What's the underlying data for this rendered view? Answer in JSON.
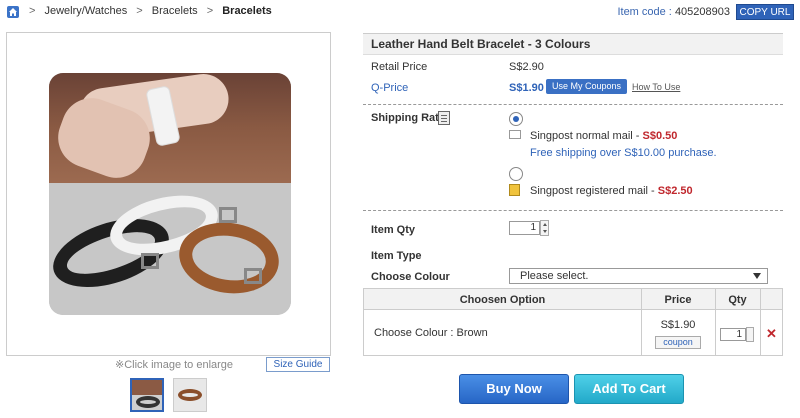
{
  "breadcrumb": {
    "items": [
      "Jewelry/Watches",
      "Bracelets",
      "Bracelets"
    ],
    "separator": ">"
  },
  "item_code": {
    "label": "Item code :",
    "value": "405208903"
  },
  "copy_url_label": "COPY URL",
  "gallery": {
    "enlarge_hint": "※Click image to enlarge",
    "size_guide_label": "Size Guide",
    "thumbnail_count": 2,
    "selected_thumbnail": 1
  },
  "product": {
    "title": "Leather Hand Belt Bracelet - 3 Colours",
    "retail_label": "Retail Price",
    "retail_price": "S$2.90",
    "qprice_label": "Q-Price",
    "qprice": "S$1.90",
    "use_coupons_label": "Use My Coupons",
    "how_to_use_label": "How To Use"
  },
  "shipping": {
    "label": "Shipping Rate",
    "options": [
      {
        "name": "Singpost normal mail -",
        "price": "S$0.50",
        "note": "Free shipping over S$10.00 purchase.",
        "selected": true
      },
      {
        "name": "Singpost registered mail -",
        "price": "S$2.50",
        "note": "",
        "selected": false
      }
    ]
  },
  "order": {
    "qty_label": "Item Qty",
    "qty_value": "1",
    "type_label": "Item Type",
    "colour_label": "Choose Colour",
    "colour_select": "Please select."
  },
  "option_table": {
    "headers": [
      "Choosen Option",
      "Price",
      "Qty"
    ],
    "rows": [
      {
        "option": "Choose Colour : Brown",
        "price": "S$1.90",
        "coupon_label": "coupon",
        "qty": "1"
      }
    ]
  },
  "actions": {
    "buy_now": "Buy Now",
    "add_to_cart": "Add To Cart"
  },
  "colors": {
    "accent_blue": "#2f63b8",
    "price_red": "#c0272d",
    "buy_now": "#2766c6",
    "add_to_cart": "#22a9c9"
  }
}
